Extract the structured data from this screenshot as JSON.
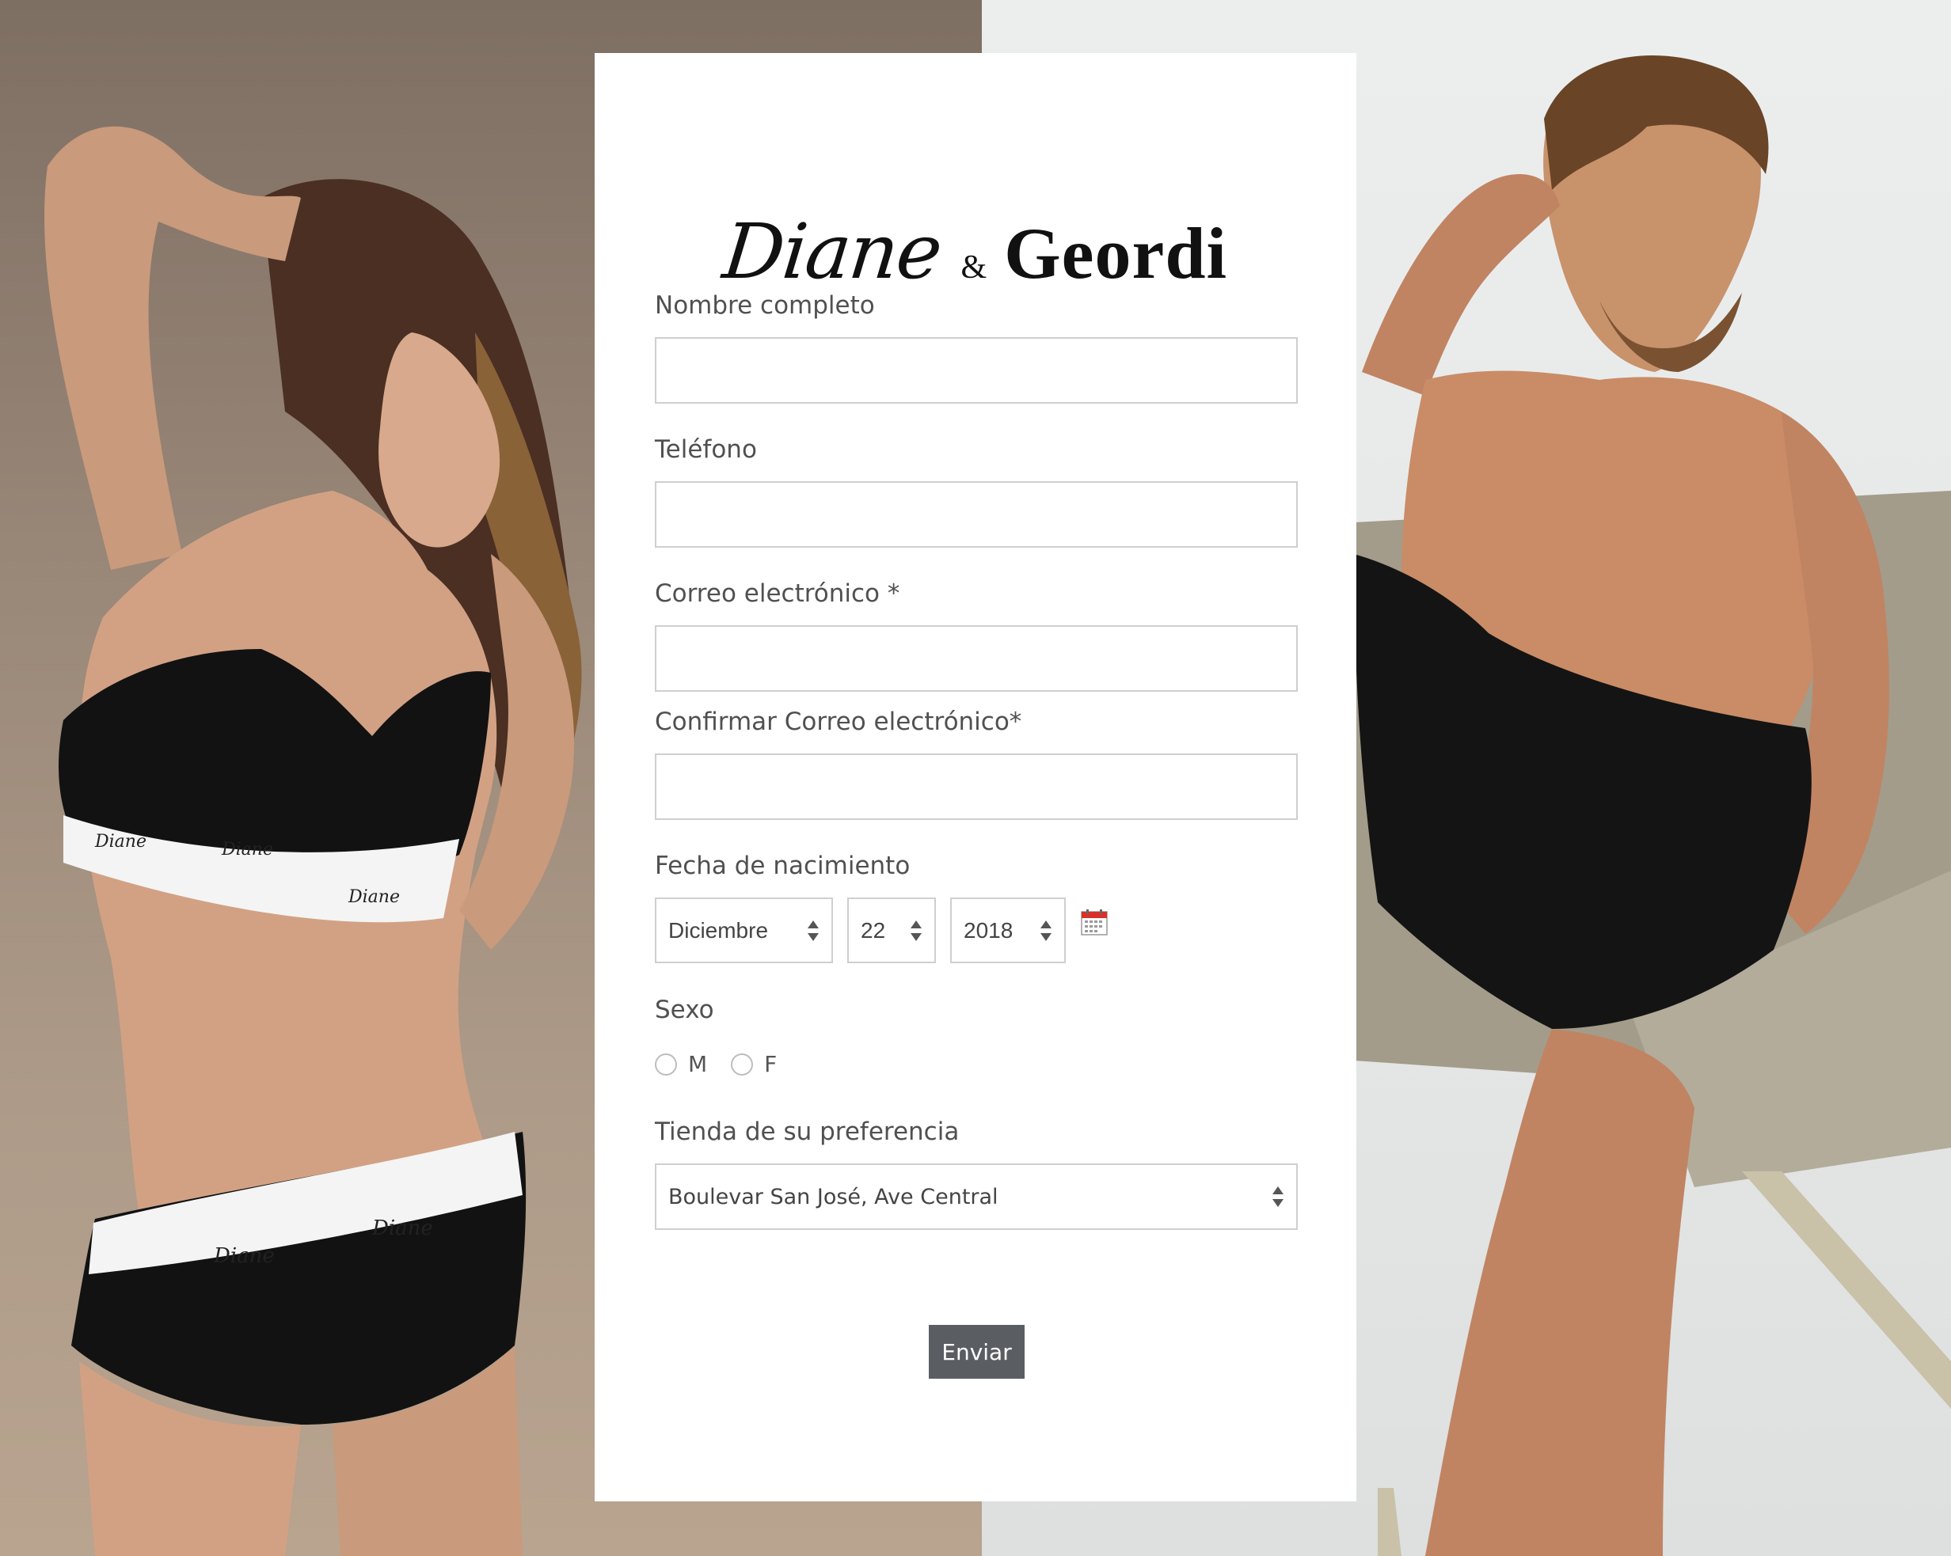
{
  "brand": {
    "logo_left": "Diane",
    "logo_amp": "&",
    "logo_right": "Geordi"
  },
  "form": {
    "full_name_label": "Nombre completo",
    "full_name_value": "",
    "phone_label": "Teléfono",
    "phone_value": "",
    "email_label": "Correo electrónico *",
    "email_value": "",
    "confirm_email_label": "Confirmar Correo electrónico*",
    "confirm_email_value": "",
    "birthdate_label": "Fecha de nacimiento",
    "birth_month": "Diciembre",
    "birth_day": "22",
    "birth_year": "2018",
    "calendar_icon": "calendar-icon",
    "sex_label": "Sexo",
    "sex_options": [
      "M",
      "F"
    ],
    "store_label": "Tienda de su preferencia",
    "store_value": "Boulevar San José, Ave Central",
    "submit_label": "Enviar"
  },
  "photos": {
    "left_band_text": "Diane",
    "right_icon": "model-photo"
  },
  "colors": {
    "button_bg": "#5a5e63",
    "field_border": "#cfcfcf",
    "label_text": "#505050",
    "left_bg": "#988677",
    "right_bg": "#e6e8e8"
  }
}
